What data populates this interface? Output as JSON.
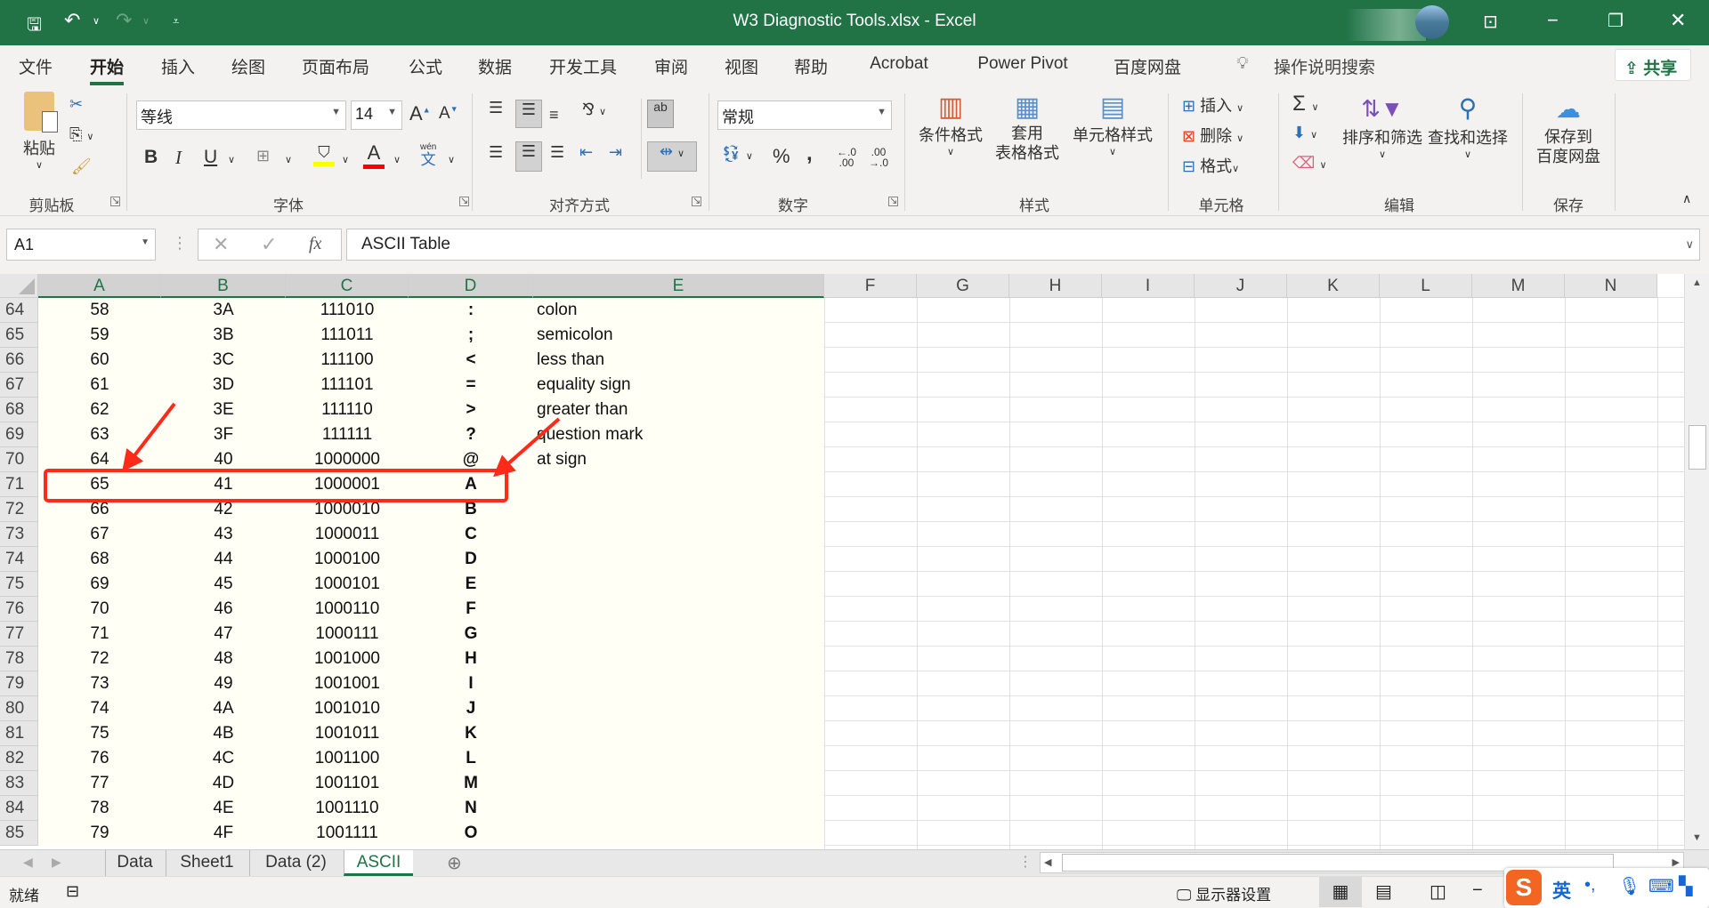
{
  "titlebar": {
    "title": "W3 Diagnostic Tools.xlsx  -  Excel"
  },
  "menu": [
    "文件",
    "开始",
    "插入",
    "绘图",
    "页面布局",
    "公式",
    "数据",
    "开发工具",
    "审阅",
    "视图",
    "帮助",
    "Acrobat",
    "Power Pivot",
    "百度网盘"
  ],
  "search_label": "操作说明搜索",
  "share_label": "共享",
  "ribbon": {
    "clipboard": {
      "paste": "粘贴",
      "label": "剪贴板"
    },
    "font": {
      "name": "等线",
      "size": "14",
      "bold": "B",
      "italic": "I",
      "underline": "U",
      "phonetic_top": "wén",
      "phonetic": "文",
      "label": "字体"
    },
    "alignment": {
      "wrap": "ab",
      "label": "对齐方式"
    },
    "number": {
      "format": "常规",
      "percent": "%",
      "comma": ",",
      "label": "数字"
    },
    "styles": {
      "conditional": "条件格式",
      "table1": "套用",
      "table2": "表格格式",
      "cell_styles": "单元格样式",
      "label": "样式"
    },
    "cells": {
      "insert": "插入",
      "delete": "删除",
      "format": "格式",
      "label": "单元格"
    },
    "editing": {
      "sum": "Σ",
      "sort": "排序和筛选",
      "find": "查找和选择",
      "label": "编辑"
    },
    "save": {
      "line1": "保存到",
      "line2": "百度网盘",
      "label": "保存"
    }
  },
  "formula_bar": {
    "name_box": "A1",
    "fx": "fx",
    "content": "ASCII Table"
  },
  "columns": [
    "A",
    "B",
    "C",
    "D",
    "E",
    "F",
    "G",
    "H",
    "I",
    "J",
    "K",
    "L",
    "M",
    "N"
  ],
  "rows": [
    {
      "n": "64",
      "a": "58",
      "b": "3A",
      "c": "111010",
      "d": ":",
      "e": "colon"
    },
    {
      "n": "65",
      "a": "59",
      "b": "3B",
      "c": "111011",
      "d": ";",
      "e": "semicolon"
    },
    {
      "n": "66",
      "a": "60",
      "b": "3C",
      "c": "111100",
      "d": "<",
      "e": "less than"
    },
    {
      "n": "67",
      "a": "61",
      "b": "3D",
      "c": "111101",
      "d": "=",
      "e": "equality sign"
    },
    {
      "n": "68",
      "a": "62",
      "b": "3E",
      "c": "111110",
      "d": ">",
      "e": "greater than"
    },
    {
      "n": "69",
      "a": "63",
      "b": "3F",
      "c": "111111",
      "d": "?",
      "e": "question mark"
    },
    {
      "n": "70",
      "a": "64",
      "b": "40",
      "c": "1000000",
      "d": "@",
      "e": "at sign"
    },
    {
      "n": "71",
      "a": "65",
      "b": "41",
      "c": "1000001",
      "d": "A",
      "e": ""
    },
    {
      "n": "72",
      "a": "66",
      "b": "42",
      "c": "1000010",
      "d": "B",
      "e": ""
    },
    {
      "n": "73",
      "a": "67",
      "b": "43",
      "c": "1000011",
      "d": "C",
      "e": ""
    },
    {
      "n": "74",
      "a": "68",
      "b": "44",
      "c": "1000100",
      "d": "D",
      "e": ""
    },
    {
      "n": "75",
      "a": "69",
      "b": "45",
      "c": "1000101",
      "d": "E",
      "e": ""
    },
    {
      "n": "76",
      "a": "70",
      "b": "46",
      "c": "1000110",
      "d": "F",
      "e": ""
    },
    {
      "n": "77",
      "a": "71",
      "b": "47",
      "c": "1000111",
      "d": "G",
      "e": ""
    },
    {
      "n": "78",
      "a": "72",
      "b": "48",
      "c": "1001000",
      "d": "H",
      "e": ""
    },
    {
      "n": "79",
      "a": "73",
      "b": "49",
      "c": "1001001",
      "d": "I",
      "e": ""
    },
    {
      "n": "80",
      "a": "74",
      "b": "4A",
      "c": "1001010",
      "d": "J",
      "e": ""
    },
    {
      "n": "81",
      "a": "75",
      "b": "4B",
      "c": "1001011",
      "d": "K",
      "e": ""
    },
    {
      "n": "82",
      "a": "76",
      "b": "4C",
      "c": "1001100",
      "d": "L",
      "e": ""
    },
    {
      "n": "83",
      "a": "77",
      "b": "4D",
      "c": "1001101",
      "d": "M",
      "e": ""
    },
    {
      "n": "84",
      "a": "78",
      "b": "4E",
      "c": "1001110",
      "d": "N",
      "e": ""
    },
    {
      "n": "85",
      "a": "79",
      "b": "4F",
      "c": "1001111",
      "d": "O",
      "e": ""
    }
  ],
  "sheet_tabs": [
    "Data",
    "Sheet1",
    "Data (2)",
    "ASCII"
  ],
  "active_sheet": "ASCII",
  "status": {
    "ready": "就绪",
    "display_settings": "显示器设置",
    "ime_lang": "英"
  },
  "colors": {
    "accent": "#217346",
    "highlight": "#ff2a1a",
    "data_fill": "#fffff6"
  }
}
